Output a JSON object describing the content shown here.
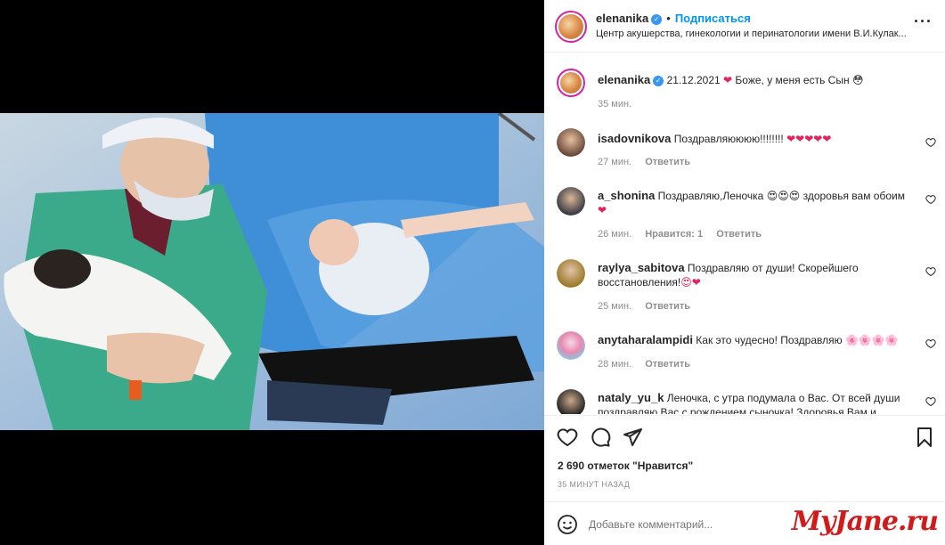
{
  "post": {
    "author": "elenanika",
    "follow_label": "Подписаться",
    "separator": "•",
    "location": "Центр акушерства, гинекологии и перинатологии имени В.И.Кулак...",
    "caption_text": "21.12.2021",
    "caption_text2": "Боже, у меня есть Сын",
    "caption_time": "35 мин."
  },
  "comments": [
    {
      "user": "isadovnikova",
      "text": "Поздравляюююю!!!!!!!!",
      "emoji": "❤❤❤❤❤",
      "time": "27 мин.",
      "likes": "",
      "reply": "Ответить"
    },
    {
      "user": "a_shonina",
      "text": "Поздравляю,Леночка",
      "emoji": "😍😍😍",
      "text2": "здоровья вам обоим",
      "emoji2": "❤",
      "time": "26 мин.",
      "likes": "Нравится: 1",
      "reply": "Ответить"
    },
    {
      "user": "raylya_sabitova",
      "text": "Поздравляю от души! Скорейшего восстановления!",
      "emoji": "😍❤",
      "time": "25 мин.",
      "likes": "",
      "reply": "Ответить"
    },
    {
      "user": "anytaharalampidi",
      "text": "Как это чудесно! Поздравляю",
      "emoji": "🌸🌸🌸🌸",
      "time": "28 мин.",
      "likes": "",
      "reply": "Ответить"
    },
    {
      "user": "nataly_yu_k",
      "text": "Леночка, с утра подумала о Вас. От всей души поздравляю Вас с рождением сыночка! Здоровья Вам и",
      "time": "",
      "likes": "",
      "reply": ""
    }
  ],
  "stats": {
    "likes_label": "2 690 отметок \"Нравится\"",
    "posted_ago": "35 МИНУТ НАЗАД"
  },
  "composer": {
    "placeholder": "Добавьте комментарий..."
  },
  "watermark": "MyJane.ru",
  "icons": {
    "more": "more-icon",
    "like": "heart-icon",
    "comment": "comment-icon",
    "share": "share-icon",
    "save": "bookmark-icon",
    "emoji": "smile-icon"
  },
  "colors": {
    "link": "#0095f6",
    "verified": "#3897f0",
    "heart": "#e0245e"
  }
}
